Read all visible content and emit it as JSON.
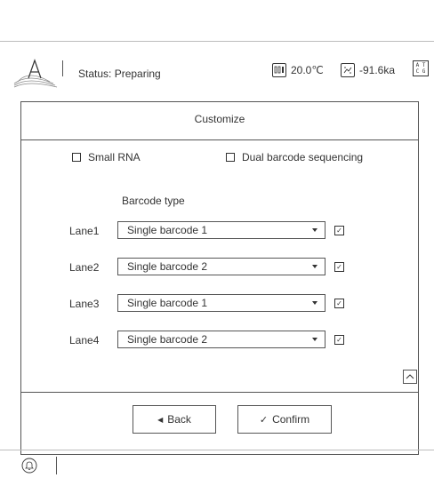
{
  "header": {
    "status_label": "Status: Preparing",
    "temperature": "20.0℃",
    "pressure": "-91.6ka",
    "atcg_top": "A T",
    "atcg_bottom": "C G"
  },
  "panel": {
    "title": "Customize",
    "options": [
      {
        "label": "Small RNA",
        "checked": false
      },
      {
        "label": "Dual barcode sequencing",
        "checked": false
      }
    ],
    "column_header": "Barcode type",
    "lanes": [
      {
        "label": "Lane1",
        "value": "Single barcode 1",
        "checked": true
      },
      {
        "label": "Lane2",
        "value": "Single barcode 2",
        "checked": true
      },
      {
        "label": "Lane3",
        "value": "Single barcode 1",
        "checked": true
      },
      {
        "label": "Lane4",
        "value": "Single barcode 2",
        "checked": true
      }
    ],
    "back_label": "Back",
    "confirm_label": "Confirm"
  },
  "icons": {
    "logo": "logo-a-icon",
    "thermometer": "thermometer-icon",
    "pressure": "pressure-icon",
    "bell": "bell-icon"
  }
}
